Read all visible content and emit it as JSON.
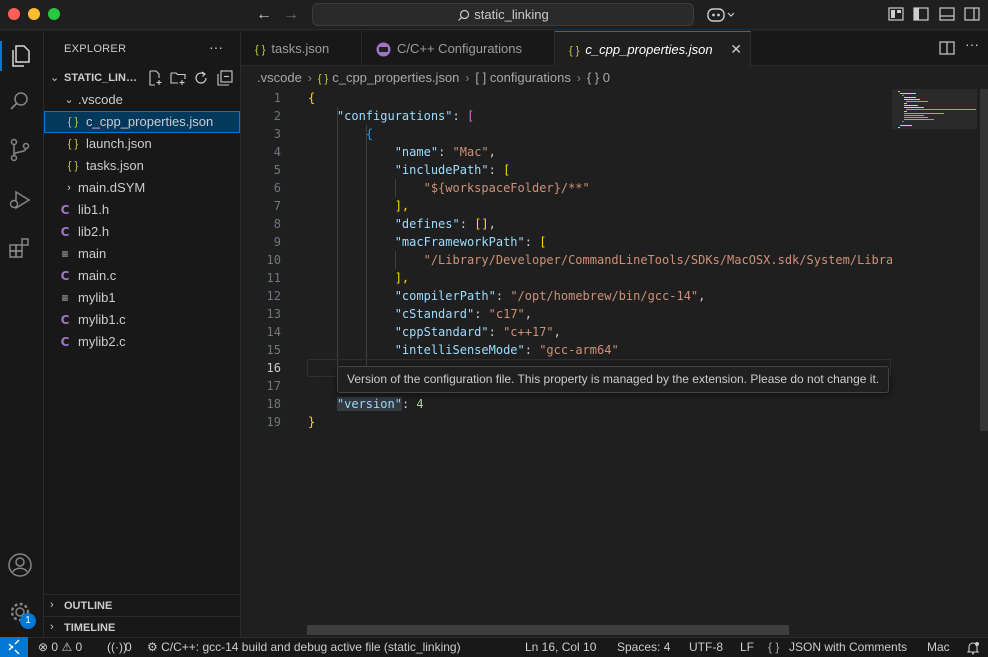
{
  "titlebar": {
    "search_text": "static_linking"
  },
  "activity": {
    "badge": "1"
  },
  "sidebar": {
    "title": "EXPLORER",
    "more": "···",
    "section_title": "STATIC_LINKING",
    "tree": [
      {
        "label": ".vscode",
        "icon": "⌄",
        "type": "folder-open"
      },
      {
        "label": "c_cpp_properties.json",
        "icon": "{ }",
        "type": "json"
      },
      {
        "label": "launch.json",
        "icon": "{ }",
        "type": "json"
      },
      {
        "label": "tasks.json",
        "icon": "{ }",
        "type": "json"
      },
      {
        "label": "main.dSYM",
        "icon": "›",
        "type": "folder"
      },
      {
        "label": "lib1.h",
        "icon": "C",
        "type": "c"
      },
      {
        "label": "lib2.h",
        "icon": "C",
        "type": "c"
      },
      {
        "label": "main",
        "icon": "≡",
        "type": "plain"
      },
      {
        "label": "main.c",
        "icon": "C",
        "type": "c"
      },
      {
        "label": "mylib1",
        "icon": "≡",
        "type": "plain"
      },
      {
        "label": "mylib1.c",
        "icon": "C",
        "type": "c"
      },
      {
        "label": "mylib2.c",
        "icon": "C",
        "type": "c"
      }
    ],
    "outline_label": "OUTLINE",
    "timeline_label": "TIMELINE"
  },
  "tabs": [
    {
      "label": "tasks.json",
      "icon": "{ }"
    },
    {
      "label": "C/C++ Configurations",
      "icon": ""
    },
    {
      "label": "c_cpp_properties.json",
      "icon": "{ }",
      "close": "✕"
    }
  ],
  "breadcrumb": {
    "folder": ".vscode",
    "file": "c_cpp_properties.json",
    "array_icon": "[ ]",
    "array": "configurations",
    "obj_icon": "{ }",
    "obj": "0"
  },
  "editor": {
    "line_numbers": [
      "1",
      "2",
      "3",
      "4",
      "5",
      "6",
      "7",
      "8",
      "9",
      "10",
      "11",
      "12",
      "13",
      "14",
      "15",
      "16",
      "17",
      "18",
      "19"
    ],
    "code": {
      "l1": "{",
      "l2_key": "\"configurations\"",
      "l2_colon": ": ",
      "l2_br": "[",
      "l3": "{",
      "l4_key": "\"name\"",
      "l4_val": "\"Mac\"",
      "l5_key": "\"includePath\"",
      "l5_br": "[",
      "l6_val": "\"${workspaceFolder}/**\"",
      "l7": "],",
      "l8_key": "\"defines\"",
      "l8_val": "[]",
      "l9_key": "\"macFrameworkPath\"",
      "l9_br": "[",
      "l10_val": "\"/Library/Developer/CommandLineTools/SDKs/MacOSX.sdk/System/Libra",
      "l11": "],",
      "l12_key": "\"compilerPath\"",
      "l12_val": "\"/opt/homebrew/bin/gcc-14\"",
      "l13_key": "\"cStandard\"",
      "l13_val": "\"c17\"",
      "l14_key": "\"cppStandard\"",
      "l14_val": "\"c++17\"",
      "l15_key": "\"intelliSenseMode\"",
      "l15_val": "\"gcc-arm64\"",
      "l18_key": "\"version\"",
      "l18_val": "4",
      "l19": "}"
    },
    "tooltip": "Version of the configuration file. This property is managed by the extension. Please do not change it."
  },
  "status": {
    "errors": "0",
    "warnings": "0",
    "ports": "0",
    "task": "C/C++: gcc-14 build and debug active file (static_linking)",
    "position": "Ln 16, Col 10",
    "spaces": "Spaces: 4",
    "encoding": "UTF-8",
    "eol": "LF",
    "language_icon": "{ }",
    "language": "JSON with Comments",
    "config": "Mac"
  },
  "colors": {
    "accent": "#0078d4",
    "json_icon": "#cbcb41",
    "c_icon": "#a074c4"
  }
}
